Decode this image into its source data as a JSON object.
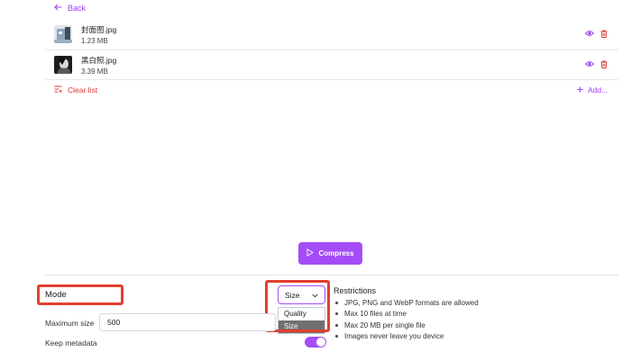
{
  "nav": {
    "back_label": "Back"
  },
  "files": [
    {
      "name": "封面图.jpg",
      "size": "1.23 MB"
    },
    {
      "name": "黑白照.jpg",
      "size": "3.39 MB"
    }
  ],
  "list_actions": {
    "clear_label": "Clear list",
    "add_label": "Add..."
  },
  "compress_label": "Compress",
  "settings": {
    "mode_label": "Mode",
    "mode_selected": "Size",
    "mode_options": [
      "Quality",
      "Size"
    ],
    "max_size_label": "Maximum size",
    "max_size_value": "500",
    "keep_metadata_label": "Keep metadata",
    "keep_metadata": true
  },
  "restrictions": {
    "title": "Restrictions",
    "items": [
      "JPG, PNG and WebP formats are allowed",
      "Max 10 files at time",
      "Max 20 MB per single file",
      "Images never leave you device"
    ]
  },
  "colors": {
    "accent": "#a44cf7",
    "danger": "#e0363a",
    "highlight": "#e23f2e"
  }
}
